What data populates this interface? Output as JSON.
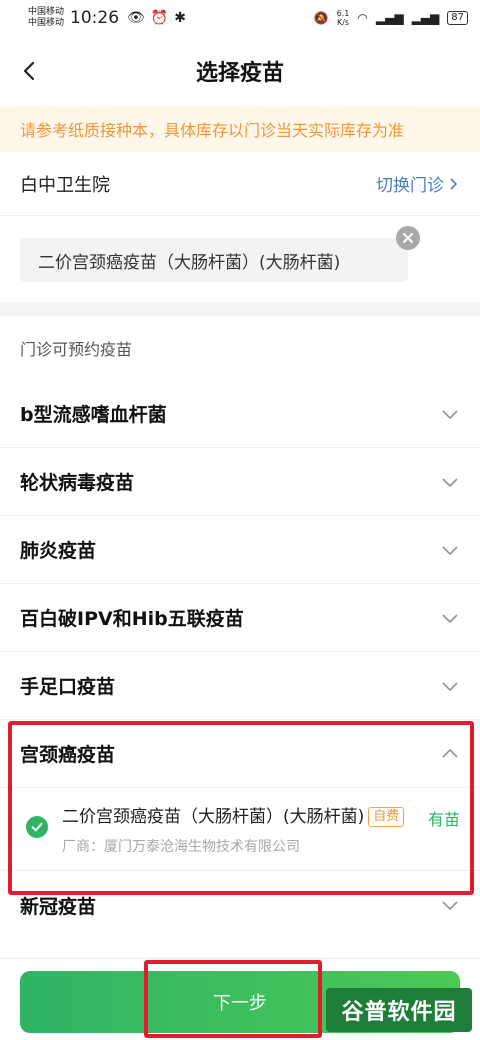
{
  "status_bar": {
    "carrier1": "中国移动",
    "carrier2": "中国移动",
    "time": "10:26",
    "speed_value": "6.1",
    "speed_unit": "K/s",
    "battery": "87"
  },
  "nav": {
    "title": "选择疫苗"
  },
  "notice": "请参考纸质接种本，具体库存以门诊当天实际库存为准",
  "clinic": {
    "name": "白中卫生院",
    "switch_label": "切换门诊"
  },
  "selected_tag": "二价宫颈癌疫苗（大肠杆菌）(大肠杆菌)",
  "section_header": "门诊可预约疫苗",
  "categories": [
    {
      "label": "b型流感嗜血杆菌"
    },
    {
      "label": "轮状病毒疫苗"
    },
    {
      "label": "肺炎疫苗"
    },
    {
      "label": "百白破IPV和Hib五联疫苗"
    },
    {
      "label": "手足口疫苗"
    },
    {
      "label": "宫颈癌疫苗"
    },
    {
      "label": "新冠疫苗"
    }
  ],
  "expanded_item": {
    "title": "二价宫颈癌疫苗（大肠杆菌）(大肠杆菌)",
    "badge": "自费",
    "maker": "厂商：厦门万泰沧海生物技术有限公司",
    "stock": "有苗"
  },
  "next_button": "下一步",
  "watermark": "谷普软件园",
  "colors": {
    "accent_green": "#2fb464",
    "notice_orange": "#f0973b",
    "link_blue": "#4a7fbf",
    "highlight_red": "#e21c2e"
  }
}
